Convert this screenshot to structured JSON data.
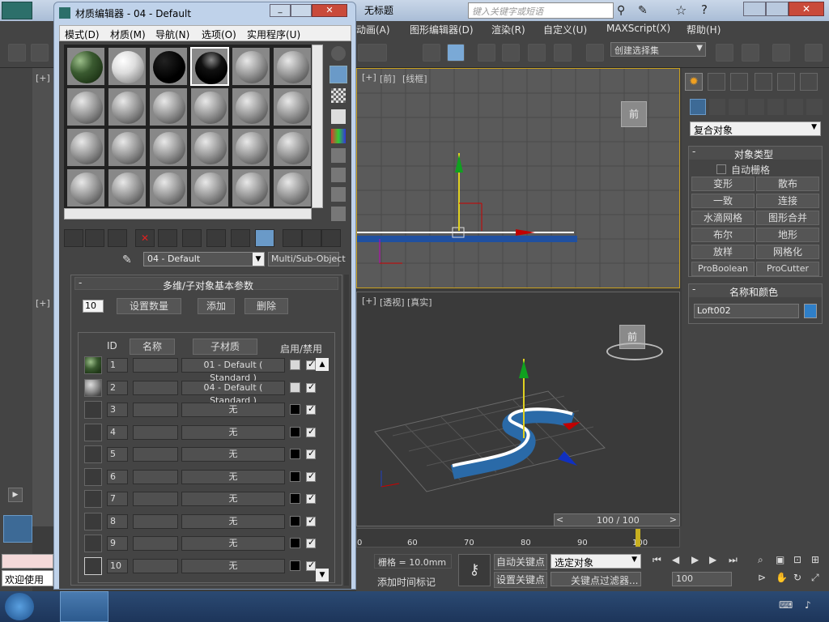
{
  "app": {
    "doc_title": "无标题",
    "search_placeholder": "键入关键字或短语",
    "menus": [
      "动画(A)",
      "图形编辑器(D)",
      "渲染(R)",
      "自定义(U)",
      "MAXScript(X)",
      "帮助(H)"
    ],
    "selection_set": "创建选择集"
  },
  "viewports": {
    "top": {
      "label_corner": "[+]",
      "label_view": "[前]",
      "label_shade": "[线框]",
      "cube_text": "前"
    },
    "persp": {
      "label_corner": "[+]",
      "label_view": "[透视]",
      "label_shade": "[真实]",
      "cube_text": "前"
    },
    "left_top_label": "[+]",
    "left_bottom_label": "[+]"
  },
  "command_panel": {
    "category": "复合对象",
    "rollout_object_type": "对象类型",
    "auto_grid": "自动栅格",
    "buttons": [
      "变形",
      "散布",
      "一致",
      "连接",
      "水滴网格",
      "图形合并",
      "布尔",
      "地形",
      "放样",
      "网格化",
      "ProBoolean",
      "ProCutter"
    ],
    "rollout_name_color": "名称和颜色",
    "object_name": "Loft002",
    "object_color": "#2f7fc8"
  },
  "timeline": {
    "frame_counter": "100 / 100",
    "ticks": [
      "0",
      "60",
      "70",
      "80",
      "90",
      "100"
    ]
  },
  "status": {
    "grid": "栅格 = 10.0mm",
    "add_time_tag": "添加时间标记",
    "auto_key": "自动关键点",
    "set_key": "设置关键点",
    "selected_object": "选定对象",
    "key_filters": "关键点过滤器...",
    "frame_field": "100",
    "welcome": "欢迎使用"
  },
  "material_editor": {
    "title": "材质编辑器 - 04 - Default",
    "menus": [
      "模式(D)",
      "材质(M)",
      "导航(N)",
      "选项(O)",
      "实用程序(U)"
    ],
    "material_name": "04 - Default",
    "material_type": "Multi/Sub-Object",
    "rollout_title": "多维/子对象基本参数",
    "count_value": "10",
    "set_count_label": "设置数量",
    "add_label": "添加",
    "delete_label": "删除",
    "col_id": "ID",
    "col_name": "名称",
    "col_submat": "子材质",
    "col_enable": "启用/禁用",
    "rows": [
      {
        "id": "1",
        "name": "",
        "submat": "01 - Default ( Standard )",
        "swatch": "#d8d8d8",
        "enabled": true
      },
      {
        "id": "2",
        "name": "",
        "submat": "04 - Default ( Standard )",
        "swatch": "#d8d8d8",
        "enabled": true
      },
      {
        "id": "3",
        "name": "",
        "submat": "无",
        "swatch": "#000000",
        "enabled": true
      },
      {
        "id": "4",
        "name": "",
        "submat": "无",
        "swatch": "#000000",
        "enabled": true
      },
      {
        "id": "5",
        "name": "",
        "submat": "无",
        "swatch": "#000000",
        "enabled": true
      },
      {
        "id": "6",
        "name": "",
        "submat": "无",
        "swatch": "#000000",
        "enabled": true
      },
      {
        "id": "7",
        "name": "",
        "submat": "无",
        "swatch": "#000000",
        "enabled": true
      },
      {
        "id": "8",
        "name": "",
        "submat": "无",
        "swatch": "#000000",
        "enabled": true
      },
      {
        "id": "9",
        "name": "",
        "submat": "无",
        "swatch": "#000000",
        "enabled": true
      },
      {
        "id": "10",
        "name": "",
        "submat": "无",
        "swatch": "#000000",
        "enabled": true
      }
    ]
  }
}
